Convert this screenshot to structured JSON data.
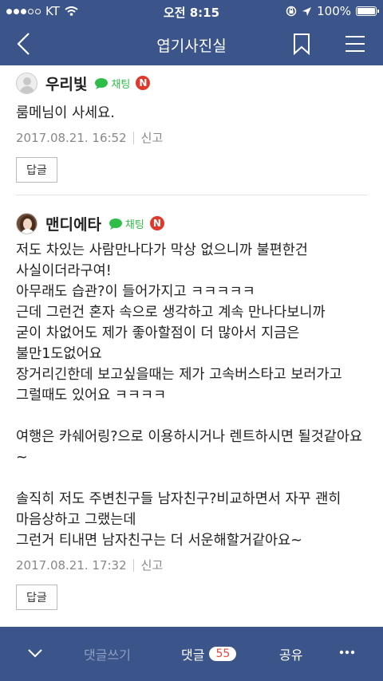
{
  "status": {
    "carrier": "KT",
    "time": "오전 8:15",
    "battery": "100%"
  },
  "nav": {
    "title": "엽기사진실"
  },
  "comments": [
    {
      "author": "우리빛",
      "chat": "채팅",
      "badge": "N",
      "text": "룸메님이 사세요.",
      "date": "2017.08.21. 16:52",
      "report": "신고",
      "reply": "답글"
    },
    {
      "author": "맨디에타",
      "chat": "채팅",
      "badge": "N",
      "text": "저도 차있는 사람만나다가 막상 없으니까 불편한건 사실이더라구여!\n아무래도 습관?이 들어가지고 ㅋㅋㅋㅋㅋ\n근데 그런건 혼자 속으로 생각하고 계속 만나다보니까\n굳이 차없어도 제가 좋아할점이 더 많아서 지금은 불만1도없어요\n장거리긴한데 보고싶을때는 제가 고속버스타고 보러가고 그럴때도 있어요 ㅋㅋㅋㅋ\n\n여행은 카쉐어링?으로 이용하시거나 렌트하시면 될것같아요~\n\n솔직히 저도 주변친구들 남자친구?비교하면서 자꾸 괜히 마음상하고 그랬는데\n그런거 티내면 남자친구는 더 서운해할거같아요~",
      "date": "2017.08.21. 17:32",
      "report": "신고",
      "reply": "답글"
    }
  ],
  "bottom": {
    "write": "댓글쓰기",
    "comments": "댓글",
    "count": "55",
    "share": "공유"
  },
  "colors": {
    "bar": "#3b5489",
    "chat": "#2fbd4a",
    "badge": "#e0392b"
  }
}
